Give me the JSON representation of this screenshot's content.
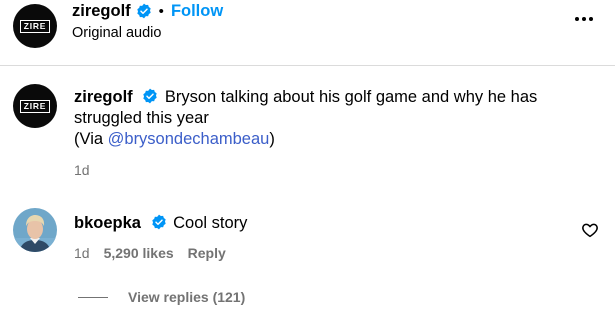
{
  "header": {
    "avatar_text": "ZIRE",
    "username": "ziregolf",
    "separator": "•",
    "follow_label": "Follow",
    "subtitle": "Original audio",
    "more_icon": "more-horizontal-icon"
  },
  "caption": {
    "avatar_text": "ZIRE",
    "username": "ziregolf",
    "text": "Bryson talking about his golf game and why he has struggled this year",
    "via_prefix": "(Via ",
    "mention": "@brysondechambeau",
    "via_suffix": ")",
    "time": "1d"
  },
  "comment": {
    "username": "bkoepka",
    "text": "Cool story",
    "time": "1d",
    "likes": "5,290 likes",
    "reply_label": "Reply",
    "heart_icon": "heart-icon"
  },
  "replies": {
    "label": "View replies (121)"
  },
  "colors": {
    "link": "#0095f6",
    "verified": "#0095f6",
    "muted": "#737373"
  }
}
